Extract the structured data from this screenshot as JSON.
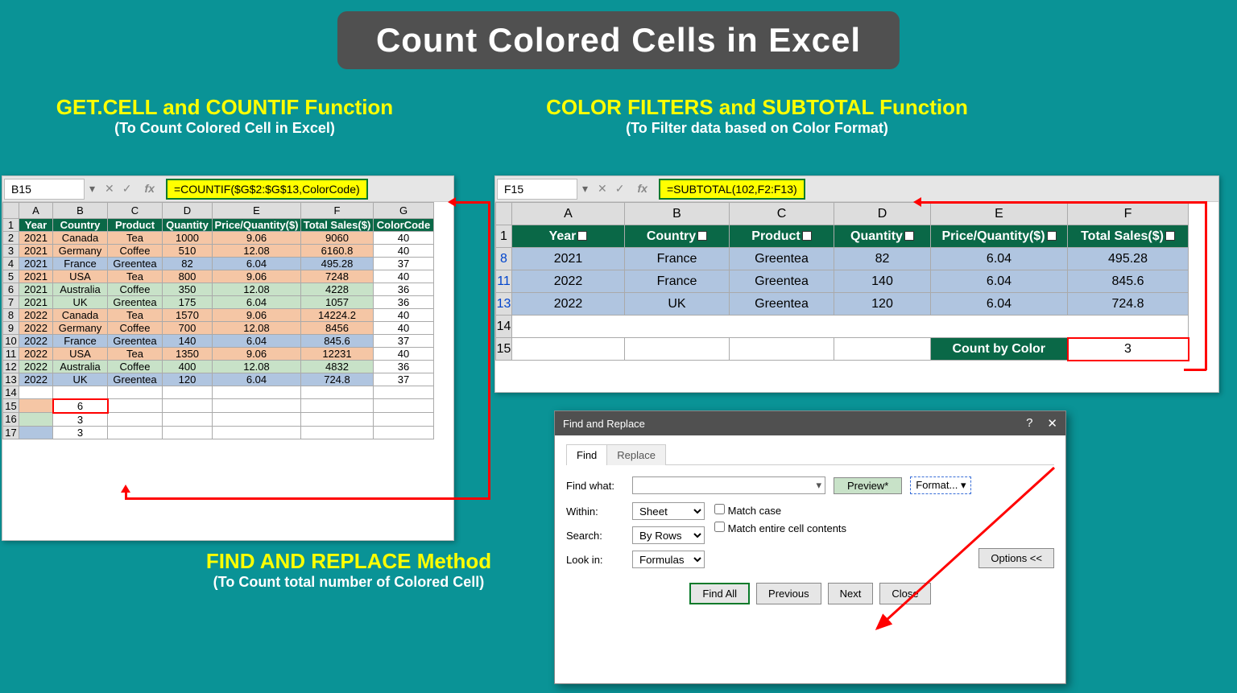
{
  "title": "Count Colored Cells in Excel",
  "sections": {
    "left": {
      "line1": "GET.CELL and COUNTIF Function",
      "line2": "(To Count Colored Cell in Excel)"
    },
    "right": {
      "line1": "COLOR FILTERS and SUBTOTAL Function",
      "line2": "(To Filter data based on Color Format)"
    },
    "bottom": {
      "line1": "FIND AND REPLACE Method",
      "line2": "(To Count total number of Colored Cell)"
    }
  },
  "left_panel": {
    "cellref": "B15",
    "formula": "=COUNTIF($G$2:$G$13,ColorCode)",
    "cols": [
      "A",
      "B",
      "C",
      "D",
      "E",
      "F",
      "G"
    ],
    "headers": [
      "Year",
      "Country",
      "Product",
      "Quantity",
      "Price/Quantity($)",
      "Total Sales($)",
      "ColorCode"
    ],
    "rows": [
      {
        "n": 2,
        "c": "orange",
        "d": [
          "2021",
          "Canada",
          "Tea",
          "1000",
          "9.06",
          "9060",
          "40"
        ]
      },
      {
        "n": 3,
        "c": "orange",
        "d": [
          "2021",
          "Germany",
          "Coffee",
          "510",
          "12.08",
          "6160.8",
          "40"
        ]
      },
      {
        "n": 4,
        "c": "blue",
        "d": [
          "2021",
          "France",
          "Greentea",
          "82",
          "6.04",
          "495.28",
          "37"
        ]
      },
      {
        "n": 5,
        "c": "orange",
        "d": [
          "2021",
          "USA",
          "Tea",
          "800",
          "9.06",
          "7248",
          "40"
        ]
      },
      {
        "n": 6,
        "c": "green",
        "d": [
          "2021",
          "Australia",
          "Coffee",
          "350",
          "12.08",
          "4228",
          "36"
        ]
      },
      {
        "n": 7,
        "c": "green",
        "d": [
          "2021",
          "UK",
          "Greentea",
          "175",
          "6.04",
          "1057",
          "36"
        ]
      },
      {
        "n": 8,
        "c": "orange",
        "d": [
          "2022",
          "Canada",
          "Tea",
          "1570",
          "9.06",
          "14224.2",
          "40"
        ]
      },
      {
        "n": 9,
        "c": "orange",
        "d": [
          "2022",
          "Germany",
          "Coffee",
          "700",
          "12.08",
          "8456",
          "40"
        ]
      },
      {
        "n": 10,
        "c": "blue",
        "d": [
          "2022",
          "France",
          "Greentea",
          "140",
          "6.04",
          "845.6",
          "37"
        ]
      },
      {
        "n": 11,
        "c": "orange",
        "d": [
          "2022",
          "USA",
          "Tea",
          "1350",
          "9.06",
          "12231",
          "40"
        ]
      },
      {
        "n": 12,
        "c": "green",
        "d": [
          "2022",
          "Australia",
          "Coffee",
          "400",
          "12.08",
          "4832",
          "36"
        ]
      },
      {
        "n": 13,
        "c": "blue",
        "d": [
          "2022",
          "UK",
          "Greentea",
          "120",
          "6.04",
          "724.8",
          "37"
        ]
      }
    ],
    "result_rows": [
      {
        "n": 14,
        "d": [
          "",
          "",
          "",
          "",
          "",
          "",
          ""
        ]
      },
      {
        "n": 15,
        "d": [
          "",
          "6",
          "",
          "",
          "",
          "",
          ""
        ],
        "hl": "B"
      },
      {
        "n": 16,
        "d": [
          "",
          "3",
          "",
          "",
          "",
          "",
          ""
        ]
      },
      {
        "n": 17,
        "d": [
          "",
          "3",
          "",
          "",
          "",
          "",
          ""
        ]
      }
    ]
  },
  "right_panel": {
    "cellref": "F15",
    "formula": "=SUBTOTAL(102,F2:F13)",
    "cols": [
      "A",
      "B",
      "C",
      "D",
      "E",
      "F"
    ],
    "headers": [
      "Year",
      "Country",
      "Product",
      "Quantity",
      "Price/Quantity($)",
      "Total Sales($)"
    ],
    "rows": [
      {
        "n": 8,
        "d": [
          "2021",
          "France",
          "Greentea",
          "82",
          "6.04",
          "495.28"
        ]
      },
      {
        "n": 11,
        "d": [
          "2022",
          "France",
          "Greentea",
          "140",
          "6.04",
          "845.6"
        ]
      },
      {
        "n": 13,
        "d": [
          "2022",
          "UK",
          "Greentea",
          "120",
          "6.04",
          "724.8"
        ]
      }
    ],
    "count_label": "Count by Color",
    "count_value": "3",
    "row14": 14,
    "row15": 15
  },
  "dialog": {
    "title": "Find and Replace",
    "tab_find": "Find",
    "tab_replace": "Replace",
    "find_what": "Find what:",
    "preview": "Preview*",
    "format": "Format...",
    "within": "Within:",
    "within_val": "Sheet",
    "search": "Search:",
    "search_val": "By Rows",
    "lookin": "Look in:",
    "lookin_val": "Formulas",
    "match_case": "Match case",
    "match_contents": "Match entire cell contents",
    "options": "Options <<",
    "find_all": "Find All",
    "previous": "Previous",
    "next": "Next",
    "close": "Close",
    "help": "?",
    "x": "✕"
  }
}
